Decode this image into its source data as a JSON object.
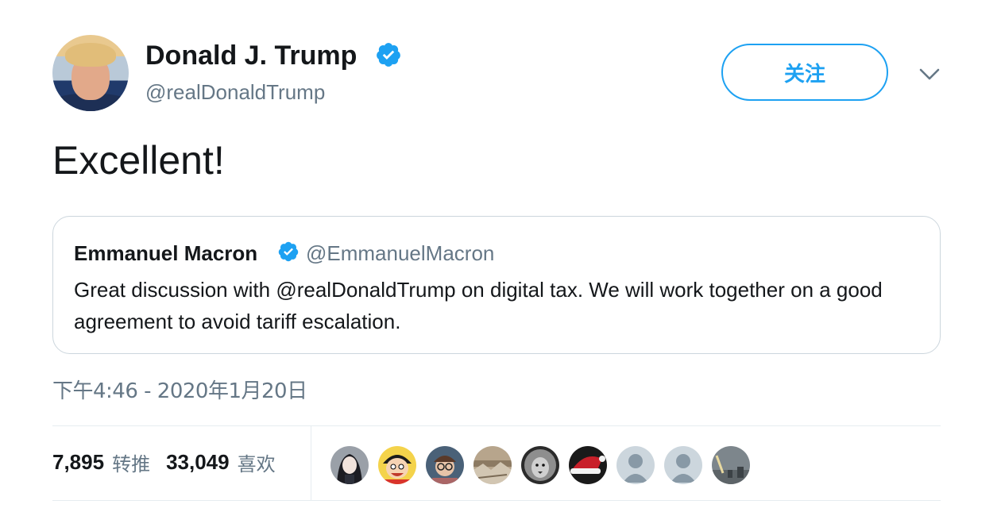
{
  "author": {
    "name": "Donald J. Trump",
    "handle": "@realDonaldTrump",
    "verified": true
  },
  "follow_button": {
    "label": "关注"
  },
  "tweet": {
    "text": "Excellent!",
    "timestamp": "下午4:46 - 2020年1月20日"
  },
  "quoted_tweet": {
    "name": "Emmanuel Macron",
    "handle": "@EmmanuelMacron",
    "verified": true,
    "text": "Great discussion with @realDonaldTrump on digital tax. We will work together on a good agreement to avoid tariff escalation."
  },
  "stats": {
    "retweets_count": "7,895",
    "retweets_label": "转推",
    "likes_count": "33,049",
    "likes_label": "喜欢"
  },
  "likers": [
    {
      "icon": "avatar-anime-girl"
    },
    {
      "icon": "avatar-anime-boy"
    },
    {
      "icon": "avatar-person-glasses"
    },
    {
      "icon": "avatar-photo-landscape"
    },
    {
      "icon": "avatar-lion"
    },
    {
      "icon": "avatar-santa-hat"
    },
    {
      "icon": "avatar-default"
    },
    {
      "icon": "avatar-default"
    },
    {
      "icon": "avatar-photo-city"
    }
  ],
  "colors": {
    "accent": "#1da1f2",
    "text": "#14171a",
    "secondary": "#657786",
    "border": "#ccd6dd"
  }
}
